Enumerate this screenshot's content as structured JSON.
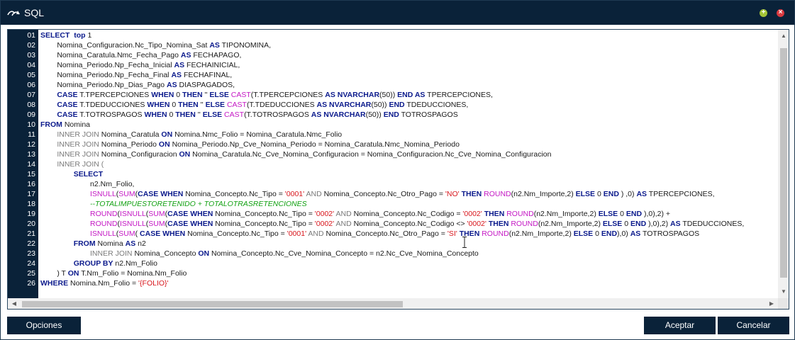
{
  "window": {
    "title": "SQL",
    "colors": {
      "titlebar": "#0a2239",
      "minimize": "#a4c436",
      "close": "#d9393f",
      "keyword": "#0b1a8c",
      "function": "#c417c4",
      "string": "#d8171d",
      "comment": "#12a112"
    },
    "icons": {
      "app": "route-arrows-icon",
      "minimize": "plus-icon",
      "close": "close-icon"
    },
    "minimize_glyph": "+",
    "close_glyph": "×"
  },
  "editor": {
    "line_numbers": [
      "01",
      "02",
      "03",
      "04",
      "05",
      "06",
      "07",
      "08",
      "09",
      "10",
      "11",
      "12",
      "13",
      "14",
      "15",
      "16",
      "17",
      "18",
      "19",
      "20",
      "21",
      "22",
      "23",
      "24",
      "25",
      "26"
    ],
    "lines": [
      [
        {
          "t": "kw",
          "v": "SELECT"
        },
        {
          "t": "plain",
          "v": "  "
        },
        {
          "t": "kw",
          "v": "top"
        },
        {
          "t": "plain",
          "v": " 1"
        }
      ],
      [
        {
          "t": "plain",
          "v": "        Nomina_Configuracion.Nc_Tipo_Nomina_Sat "
        },
        {
          "t": "kw",
          "v": "AS"
        },
        {
          "t": "plain",
          "v": " TIPONOMINA,"
        }
      ],
      [
        {
          "t": "plain",
          "v": "        Nomina_Caratula.Nmc_Fecha_Pago "
        },
        {
          "t": "kw",
          "v": "AS"
        },
        {
          "t": "plain",
          "v": " FECHAPAGO,"
        }
      ],
      [
        {
          "t": "plain",
          "v": "        Nomina_Periodo.Np_Fecha_Inicial "
        },
        {
          "t": "kw",
          "v": "AS"
        },
        {
          "t": "plain",
          "v": " FECHAINICIAL,"
        }
      ],
      [
        {
          "t": "plain",
          "v": "        Nomina_Periodo.Np_Fecha_Final "
        },
        {
          "t": "kw",
          "v": "AS"
        },
        {
          "t": "plain",
          "v": " FECHAFINAL,"
        }
      ],
      [
        {
          "t": "plain",
          "v": "        Nomina_Periodo.Np_Dias_Pago "
        },
        {
          "t": "kw",
          "v": "AS"
        },
        {
          "t": "plain",
          "v": " DIASPAGADOS,"
        }
      ],
      [
        {
          "t": "plain",
          "v": "        "
        },
        {
          "t": "kw",
          "v": "CASE"
        },
        {
          "t": "plain",
          "v": " T.TPERCEPCIONES "
        },
        {
          "t": "kw",
          "v": "WHEN"
        },
        {
          "t": "plain",
          "v": " 0 "
        },
        {
          "t": "kw",
          "v": "THEN"
        },
        {
          "t": "plain",
          "v": " '' "
        },
        {
          "t": "kw",
          "v": "ELSE"
        },
        {
          "t": "plain",
          "v": " "
        },
        {
          "t": "fn",
          "v": "CAST"
        },
        {
          "t": "plain",
          "v": "(T.TPERCEPCIONES "
        },
        {
          "t": "kw",
          "v": "AS NVARCHAR"
        },
        {
          "t": "plain",
          "v": "(50)) "
        },
        {
          "t": "kw",
          "v": "END AS"
        },
        {
          "t": "plain",
          "v": " TPERCEPCIONES,"
        }
      ],
      [
        {
          "t": "plain",
          "v": "        "
        },
        {
          "t": "kw",
          "v": "CASE"
        },
        {
          "t": "plain",
          "v": " T.TDEDUCCIONES "
        },
        {
          "t": "kw",
          "v": "WHEN"
        },
        {
          "t": "plain",
          "v": " 0 "
        },
        {
          "t": "kw",
          "v": "THEN"
        },
        {
          "t": "plain",
          "v": " '' "
        },
        {
          "t": "kw",
          "v": "ELSE"
        },
        {
          "t": "plain",
          "v": " "
        },
        {
          "t": "fn",
          "v": "CAST"
        },
        {
          "t": "plain",
          "v": "(T.TDEDUCCIONES "
        },
        {
          "t": "kw",
          "v": "AS NVARCHAR"
        },
        {
          "t": "plain",
          "v": "(50)) "
        },
        {
          "t": "kw",
          "v": "END"
        },
        {
          "t": "plain",
          "v": " TDEDUCCIONES,"
        }
      ],
      [
        {
          "t": "plain",
          "v": "        "
        },
        {
          "t": "kw",
          "v": "CASE"
        },
        {
          "t": "plain",
          "v": " T.TOTROSPAGOS "
        },
        {
          "t": "kw",
          "v": "WHEN"
        },
        {
          "t": "plain",
          "v": " 0 "
        },
        {
          "t": "kw",
          "v": "THEN"
        },
        {
          "t": "plain",
          "v": " '' "
        },
        {
          "t": "kw",
          "v": "ELSE"
        },
        {
          "t": "plain",
          "v": " "
        },
        {
          "t": "fn",
          "v": "CAST"
        },
        {
          "t": "plain",
          "v": "(T.TOTROSPAGOS "
        },
        {
          "t": "kw",
          "v": "AS NVARCHAR"
        },
        {
          "t": "plain",
          "v": "(50)) "
        },
        {
          "t": "kw",
          "v": "END"
        },
        {
          "t": "plain",
          "v": " TOTROSPAGOS"
        }
      ],
      [
        {
          "t": "kw",
          "v": "FROM"
        },
        {
          "t": "plain",
          "v": " Nomina"
        }
      ],
      [
        {
          "t": "plain",
          "v": "        "
        },
        {
          "t": "gray",
          "v": "INNER JOIN"
        },
        {
          "t": "plain",
          "v": " Nomina_Caratula "
        },
        {
          "t": "kw",
          "v": "ON"
        },
        {
          "t": "plain",
          "v": " Nomina.Nmc_Folio = Nomina_Caratula.Nmc_Folio"
        }
      ],
      [
        {
          "t": "plain",
          "v": "        "
        },
        {
          "t": "gray",
          "v": "INNER JOIN"
        },
        {
          "t": "plain",
          "v": " Nomina_Periodo "
        },
        {
          "t": "kw",
          "v": "ON"
        },
        {
          "t": "plain",
          "v": " Nomina_Periodo.Np_Cve_Nomina_Periodo = Nomina_Caratula.Nmc_Nomina_Periodo"
        }
      ],
      [
        {
          "t": "plain",
          "v": "        "
        },
        {
          "t": "gray",
          "v": "INNER JOIN"
        },
        {
          "t": "plain",
          "v": " Nomina_Configuracion "
        },
        {
          "t": "kw",
          "v": "ON"
        },
        {
          "t": "plain",
          "v": " Nomina_Caratula.Nc_Cve_Nomina_Configuracion = Nomina_Configuracion.Nc_Cve_Nomina_Configuracion"
        }
      ],
      [
        {
          "t": "plain",
          "v": "        "
        },
        {
          "t": "gray",
          "v": "INNER JOIN ("
        }
      ],
      [
        {
          "t": "plain",
          "v": "                "
        },
        {
          "t": "kw",
          "v": "SELECT"
        }
      ],
      [
        {
          "t": "plain",
          "v": "                        n2.Nm_Folio,"
        }
      ],
      [
        {
          "t": "plain",
          "v": "                        "
        },
        {
          "t": "fn",
          "v": "ISNULL"
        },
        {
          "t": "plain",
          "v": "("
        },
        {
          "t": "fn",
          "v": "SUM"
        },
        {
          "t": "plain",
          "v": "("
        },
        {
          "t": "kw",
          "v": "CASE WHEN"
        },
        {
          "t": "plain",
          "v": " Nomina_Concepto.Nc_Tipo = "
        },
        {
          "t": "str",
          "v": "'0001'"
        },
        {
          "t": "plain",
          "v": " "
        },
        {
          "t": "gray",
          "v": "AND"
        },
        {
          "t": "plain",
          "v": " Nomina_Concepto.Nc_Otro_Pago = "
        },
        {
          "t": "str",
          "v": "'NO'"
        },
        {
          "t": "plain",
          "v": " "
        },
        {
          "t": "kw",
          "v": "THEN"
        },
        {
          "t": "plain",
          "v": " "
        },
        {
          "t": "fn",
          "v": "ROUND"
        },
        {
          "t": "plain",
          "v": "(n2.Nm_Importe,2) "
        },
        {
          "t": "kw",
          "v": "ELSE"
        },
        {
          "t": "plain",
          "v": " 0 "
        },
        {
          "t": "kw",
          "v": "END"
        },
        {
          "t": "plain",
          "v": " ) ,0) "
        },
        {
          "t": "kw",
          "v": "AS"
        },
        {
          "t": "plain",
          "v": " TPERCEPCIONES,"
        }
      ],
      [
        {
          "t": "plain",
          "v": "                        "
        },
        {
          "t": "cm",
          "v": "--TOTALIMPUESTORETENIDO + TOTALOTRASRETENCIONES"
        }
      ],
      [
        {
          "t": "plain",
          "v": "                        "
        },
        {
          "t": "fn",
          "v": "ROUND"
        },
        {
          "t": "plain",
          "v": "("
        },
        {
          "t": "fn",
          "v": "ISNULL"
        },
        {
          "t": "plain",
          "v": "("
        },
        {
          "t": "fn",
          "v": "SUM"
        },
        {
          "t": "plain",
          "v": "("
        },
        {
          "t": "kw",
          "v": "CASE WHEN"
        },
        {
          "t": "plain",
          "v": " Nomina_Concepto.Nc_Tipo = "
        },
        {
          "t": "str",
          "v": "'0002'"
        },
        {
          "t": "plain",
          "v": " "
        },
        {
          "t": "gray",
          "v": "AND"
        },
        {
          "t": "plain",
          "v": " Nomina_Concepto.Nc_Codigo = "
        },
        {
          "t": "str",
          "v": "'0002'"
        },
        {
          "t": "plain",
          "v": " "
        },
        {
          "t": "kw",
          "v": "THEN"
        },
        {
          "t": "plain",
          "v": " "
        },
        {
          "t": "fn",
          "v": "ROUND"
        },
        {
          "t": "plain",
          "v": "(n2.Nm_Importe,2) "
        },
        {
          "t": "kw",
          "v": "ELSE"
        },
        {
          "t": "plain",
          "v": " 0 "
        },
        {
          "t": "kw",
          "v": "END"
        },
        {
          "t": "plain",
          "v": " ),0),2) +"
        }
      ],
      [
        {
          "t": "plain",
          "v": "                        "
        },
        {
          "t": "fn",
          "v": "ROUND"
        },
        {
          "t": "plain",
          "v": "("
        },
        {
          "t": "fn",
          "v": "ISNULL"
        },
        {
          "t": "plain",
          "v": "("
        },
        {
          "t": "fn",
          "v": "SUM"
        },
        {
          "t": "plain",
          "v": "("
        },
        {
          "t": "kw",
          "v": "CASE WHEN"
        },
        {
          "t": "plain",
          "v": " Nomina_Concepto.Nc_Tipo = "
        },
        {
          "t": "str",
          "v": "'0002'"
        },
        {
          "t": "plain",
          "v": " "
        },
        {
          "t": "gray",
          "v": "AND"
        },
        {
          "t": "plain",
          "v": " Nomina_Concepto.Nc_Codigo <> "
        },
        {
          "t": "str",
          "v": "'0002'"
        },
        {
          "t": "plain",
          "v": " "
        },
        {
          "t": "kw",
          "v": "THEN"
        },
        {
          "t": "plain",
          "v": " "
        },
        {
          "t": "fn",
          "v": "ROUND"
        },
        {
          "t": "plain",
          "v": "(n2.Nm_Importe,2) "
        },
        {
          "t": "kw",
          "v": "ELSE"
        },
        {
          "t": "plain",
          "v": " 0 "
        },
        {
          "t": "kw",
          "v": "END"
        },
        {
          "t": "plain",
          "v": " ),0),2) "
        },
        {
          "t": "kw",
          "v": "AS"
        },
        {
          "t": "plain",
          "v": " TDEDUCCIONES,"
        }
      ],
      [
        {
          "t": "plain",
          "v": "                        "
        },
        {
          "t": "fn",
          "v": "ISNULL"
        },
        {
          "t": "plain",
          "v": "("
        },
        {
          "t": "fn",
          "v": "SUM"
        },
        {
          "t": "plain",
          "v": "( "
        },
        {
          "t": "kw",
          "v": "CASE WHEN"
        },
        {
          "t": "plain",
          "v": " Nomina_Concepto.Nc_Tipo = "
        },
        {
          "t": "str",
          "v": "'0001'"
        },
        {
          "t": "plain",
          "v": " "
        },
        {
          "t": "gray",
          "v": "AND"
        },
        {
          "t": "plain",
          "v": " Nomina_Concepto.Nc_Otro_Pago = "
        },
        {
          "t": "str",
          "v": "'SI'"
        },
        {
          "t": "plain",
          "v": " "
        },
        {
          "t": "kw",
          "v": "THEN"
        },
        {
          "t": "plain",
          "v": " "
        },
        {
          "t": "fn",
          "v": "ROUND"
        },
        {
          "t": "plain",
          "v": "(n2.Nm_Importe,2) "
        },
        {
          "t": "kw",
          "v": "ELSE"
        },
        {
          "t": "plain",
          "v": " 0 "
        },
        {
          "t": "kw",
          "v": "END"
        },
        {
          "t": "plain",
          "v": "),0) "
        },
        {
          "t": "kw",
          "v": "AS"
        },
        {
          "t": "plain",
          "v": " TOTROSPAGOS"
        }
      ],
      [
        {
          "t": "plain",
          "v": "                "
        },
        {
          "t": "kw",
          "v": "FROM"
        },
        {
          "t": "plain",
          "v": " Nomina "
        },
        {
          "t": "kw",
          "v": "AS"
        },
        {
          "t": "plain",
          "v": " n2"
        }
      ],
      [
        {
          "t": "plain",
          "v": "                        "
        },
        {
          "t": "gray",
          "v": "INNER JOIN"
        },
        {
          "t": "plain",
          "v": " Nomina_Concepto "
        },
        {
          "t": "kw",
          "v": "ON"
        },
        {
          "t": "plain",
          "v": " Nomina_Concepto.Nc_Cve_Nomina_Concepto = n2.Nc_Cve_Nomina_Concepto"
        }
      ],
      [
        {
          "t": "plain",
          "v": "                "
        },
        {
          "t": "kw",
          "v": "GROUP BY"
        },
        {
          "t": "plain",
          "v": " n2.Nm_Folio"
        }
      ],
      [
        {
          "t": "plain",
          "v": "        ) T "
        },
        {
          "t": "kw",
          "v": "ON"
        },
        {
          "t": "plain",
          "v": " T.Nm_Folio = Nomina.Nm_Folio"
        }
      ],
      [
        {
          "t": "kw",
          "v": "WHERE"
        },
        {
          "t": "plain",
          "v": " Nomina.Nm_Folio = "
        },
        {
          "t": "str",
          "v": "'{FOLIO}'"
        }
      ]
    ],
    "scroll": {
      "up_icon": "chevron-up-icon",
      "down_icon": "chevron-down-icon",
      "left_icon": "chevron-left-icon",
      "right_icon": "chevron-right-icon",
      "up": "▲",
      "down": "▼",
      "left": "◀",
      "right": "▶"
    }
  },
  "footer": {
    "options_label": "Opciones",
    "accept_label": "Aceptar",
    "cancel_label": "Cancelar"
  }
}
